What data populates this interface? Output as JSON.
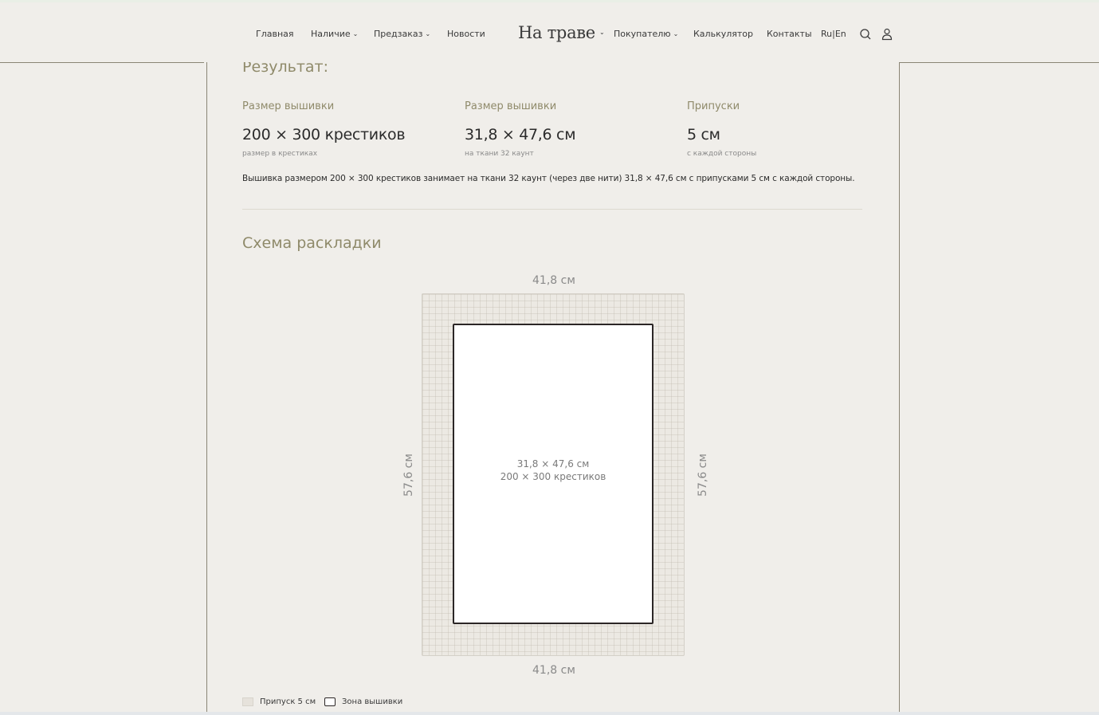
{
  "nav": {
    "home": "Главная",
    "availability": "Наличие",
    "preorder": "Предзаказ",
    "news": "Новости",
    "logo": "На траве",
    "buyer": "Покупателю",
    "calculator": "Калькулятор",
    "contacts": "Контакты",
    "lang": "Ru|En"
  },
  "result": {
    "title": "Результат:",
    "cols": [
      {
        "label": "Размер вышивки",
        "value": "200 × 300 крестиков",
        "sub": "размер в крестиках"
      },
      {
        "label": "Размер вышивки",
        "value": "31,8 × 47,6 см",
        "sub": "на ткани 32 каунт"
      },
      {
        "label": "Припуски",
        "value": "5 см",
        "sub": "с каждой стороны"
      }
    ],
    "summary": "Вышивка размером 200 × 300 крестиков занимает на ткани 32 каунт (через две нити) 31,8 × 47,6 см с припусками 5 см с каждой стороны."
  },
  "scheme": {
    "title": "Схема раскладки",
    "top_dim": "41,8 см",
    "bottom_dim": "41,8 см",
    "left_dim": "57,6 см",
    "right_dim": "57,6 см",
    "inner_line1": "31,8 × 47,6 см",
    "inner_line2": "200 × 300 крестиков"
  },
  "legend": {
    "allowance": "Припуск 5 см",
    "zone": "Зона вышивки"
  },
  "colors": {
    "background": "#f0eeea",
    "accent_text": "#8f8a6a",
    "fabric": "#ece9e3",
    "border_dark": "#2b2626"
  },
  "icons": [
    "search-icon",
    "user-icon",
    "chevron-down-icon"
  ]
}
